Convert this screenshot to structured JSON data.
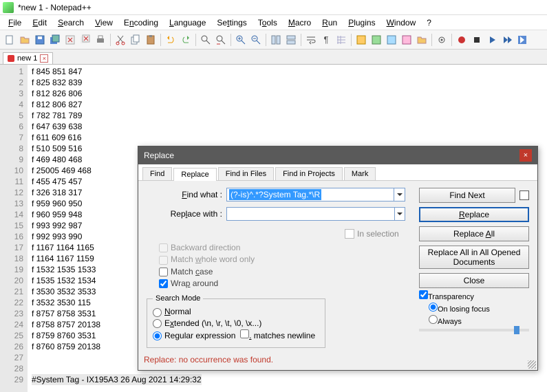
{
  "window": {
    "title": "*new 1 - Notepad++"
  },
  "menus": [
    "File",
    "Edit",
    "Search",
    "View",
    "Encoding",
    "Language",
    "Settings",
    "Tools",
    "Macro",
    "Run",
    "Plugins",
    "Window",
    "?"
  ],
  "file_tab": {
    "name": "new 1"
  },
  "lines": [
    "f 845 851 847",
    "f 825 832 839",
    "f 812 826 806",
    "f 812 806 827",
    "f 782 781 789",
    "f 647 639 638",
    "f 611 609 616",
    "f 510 509 516",
    "f 469 480 468",
    "f 25005 469 468",
    "f 455 475 457",
    "f 326 318 317",
    "f 959 960 950",
    "f 960 959 948",
    "f 993 992 987",
    "f 992 993 990",
    "f 1167 1164 1165",
    "f 1164 1167 1159",
    "f 1532 1535 1533",
    "f 1535 1532 1534",
    "f 3530 3532 3533",
    "f 3532 3530 115",
    "f 8757 8758 3531",
    "f 8758 8757 20138",
    "f 8759 8760 3531",
    "f 8760 8759 20138",
    "",
    "",
    "#System Tag - IX195A3 26 Aug 2021 14:29:32"
  ],
  "dialog": {
    "title": "Replace",
    "tabs": [
      "Find",
      "Replace",
      "Find in Files",
      "Find in Projects",
      "Mark"
    ],
    "active_tab": 1,
    "find_label": "Find what :",
    "find_value": "(?-is)^.*?System Tag.*\\R",
    "replace_label": "Replace with :",
    "replace_value": "",
    "in_selection": "In selection",
    "backward": "Backward direction",
    "whole_word": "Match whole word only",
    "match_case": "Match case",
    "wrap": "Wrap around",
    "search_mode_legend": "Search Mode",
    "mode_normal": "Normal",
    "mode_extended": "Extended (\\n, \\r, \\t, \\0, \\x...)",
    "mode_regex": "Regular expression",
    "matches_newline": ". matches newline",
    "transparency": "Transparency",
    "on_losing": "On losing focus",
    "always": "Always",
    "buttons": {
      "find_next": "Find Next",
      "replace": "Replace",
      "replace_all": "Replace All",
      "replace_all_opened": "Replace All in All Opened Documents",
      "close": "Close"
    },
    "status": "Replace: no occurrence was found."
  }
}
